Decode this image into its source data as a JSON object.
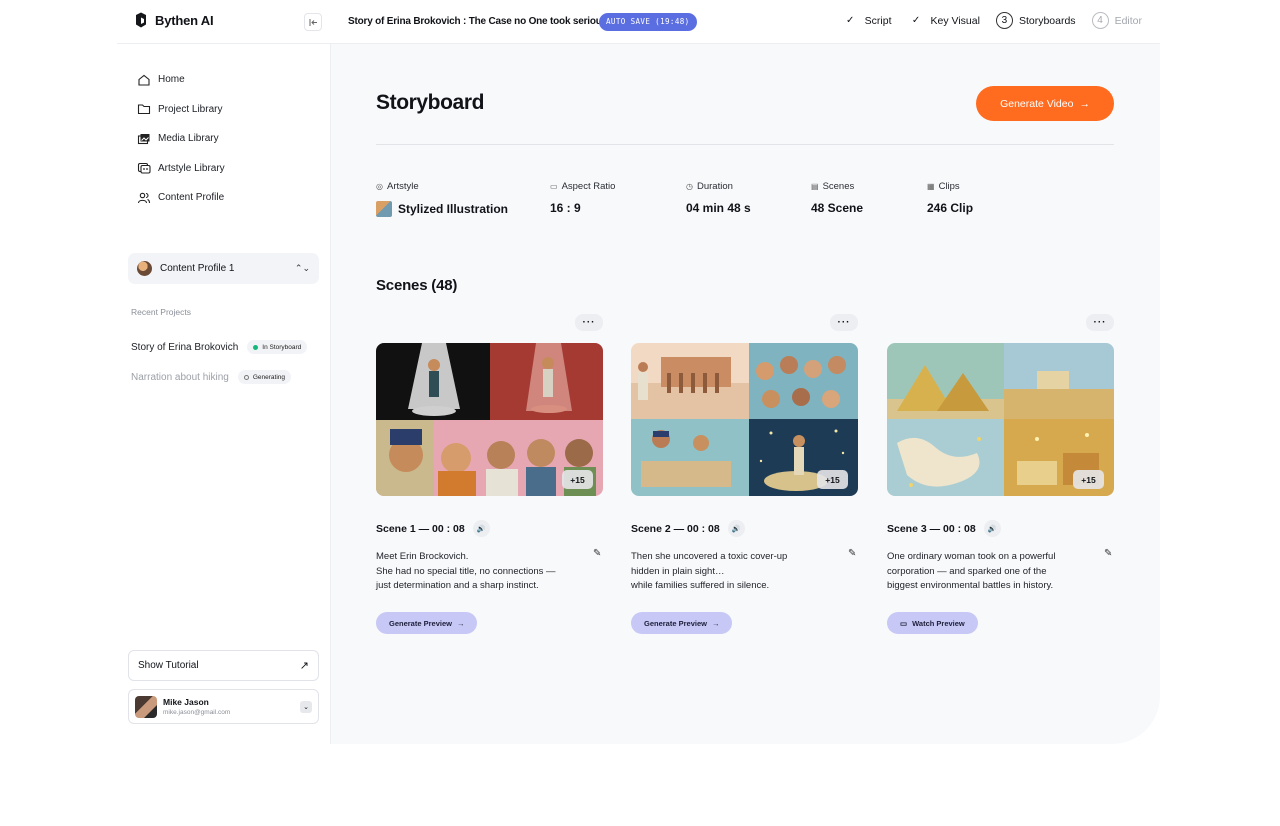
{
  "app": {
    "name": "Bythen AI"
  },
  "project": {
    "title": "Story of Erina Brokovich : The Case no One took seriously",
    "autosave": "AUTO SAVE (19:48)"
  },
  "steps": [
    {
      "label": "Script",
      "status": "done"
    },
    {
      "label": "Key Visual",
      "status": "done"
    },
    {
      "label": "Storyboards",
      "number": "3",
      "status": "current"
    },
    {
      "label": "Editor",
      "number": "4",
      "status": "disabled"
    }
  ],
  "sidebar": {
    "nav": [
      {
        "label": "Home",
        "icon": "home-icon"
      },
      {
        "label": "Project Library",
        "icon": "folder-icon"
      },
      {
        "label": "Media Library",
        "icon": "images-icon"
      },
      {
        "label": "Artstyle Library",
        "icon": "palette-icon"
      },
      {
        "label": "Content Profile",
        "icon": "users-icon"
      }
    ],
    "profile_select": "Content Profile 1",
    "recent_label": "Recent Projects",
    "recent": [
      {
        "name": "Story of Erina Brokovich",
        "status": "In Storyboard"
      },
      {
        "name": "Narration about hiking",
        "status": "Generating"
      }
    ],
    "tutorial": "Show Tutorial",
    "user": {
      "name": "Mike Jason",
      "email": "mike.jason@gmail.com"
    }
  },
  "main": {
    "title": "Storyboard",
    "generate_video": "Generate Video",
    "meta": [
      {
        "label": "Artstyle",
        "value": "Stylized Illustration"
      },
      {
        "label": "Aspect Ratio",
        "value": "16 : 9"
      },
      {
        "label": "Duration",
        "value": "04 min 48 s"
      },
      {
        "label": "Scenes",
        "value": "48 Scene"
      },
      {
        "label": "Clips",
        "value": "246 Clip"
      }
    ],
    "scenes_title": "Scenes (48)",
    "scenes": [
      {
        "title": "Scene 1 — 00 : 08",
        "more_count": "+15",
        "lines": [
          "Meet Erin Brockovich.",
          "She had no special title, no connections —",
          "just determination and a sharp instinct."
        ],
        "button": "Generate Preview"
      },
      {
        "title": "Scene 2 — 00 : 08",
        "more_count": "+15",
        "lines": [
          "Then she uncovered a toxic cover-up",
          "hidden in plain sight…",
          "while families suffered in silence."
        ],
        "button": "Generate Preview"
      },
      {
        "title": "Scene 3 — 00 : 08",
        "more_count": "+15",
        "lines": [
          "One ordinary woman took on a powerful",
          "corporation — and sparked one of the",
          "biggest environmental battles in history."
        ],
        "button": "Watch Preview"
      }
    ]
  },
  "colors": {
    "accent_orange": "#ff6b1f",
    "autosave_blue": "#5b6ee1",
    "preview_button": "#c7c8f5",
    "status_green": "#14b87a"
  }
}
